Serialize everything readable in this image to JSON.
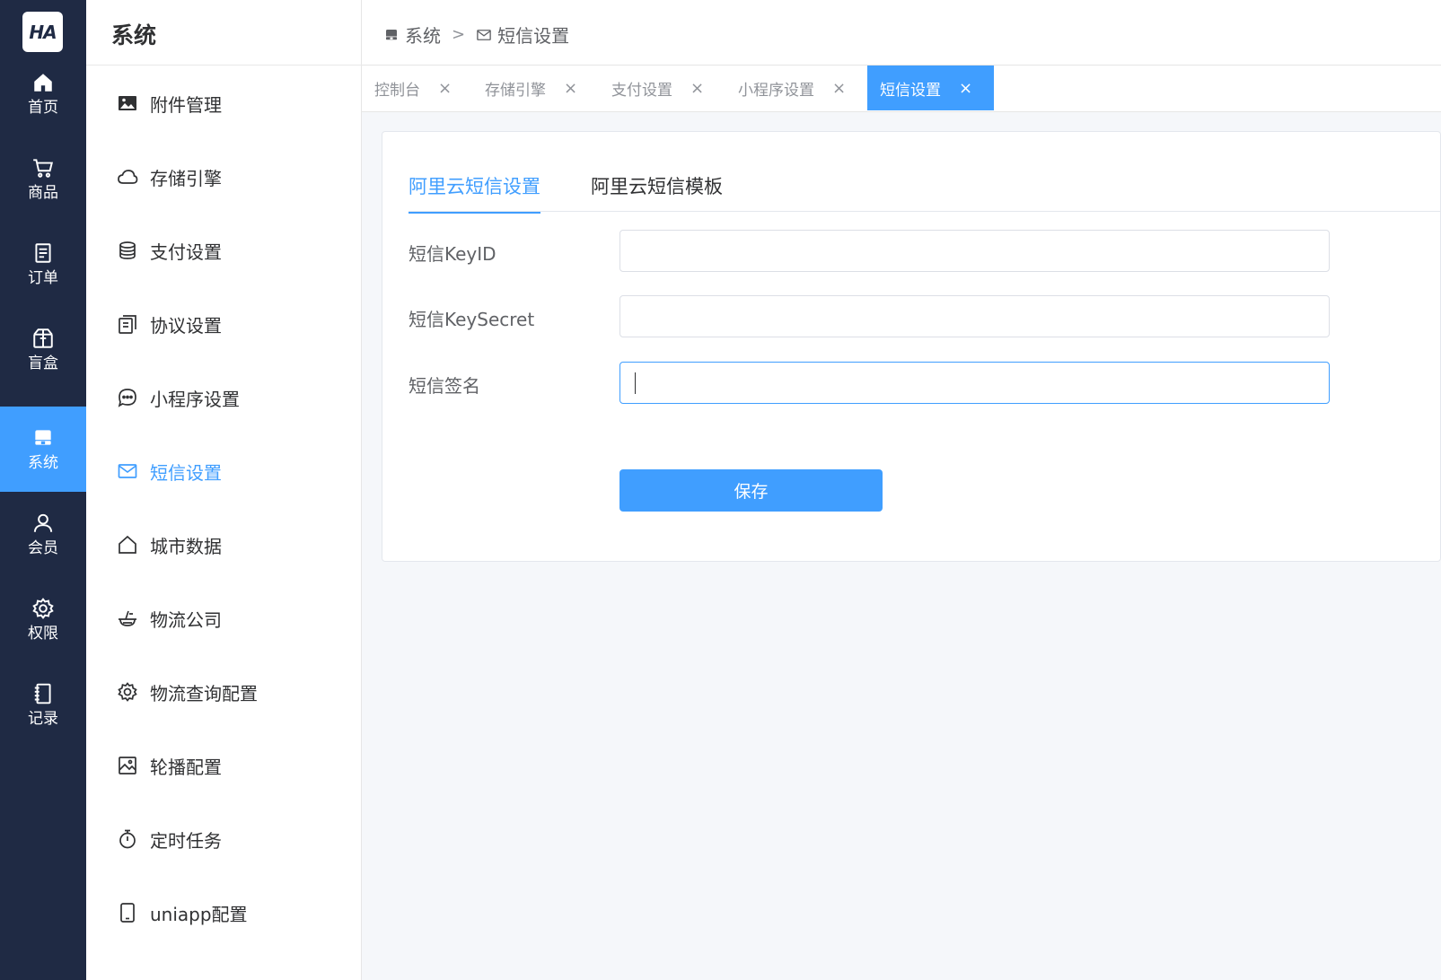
{
  "brand": {
    "logo_text": "HA"
  },
  "rail": {
    "items": [
      {
        "label": "首页",
        "icon": "home-icon"
      },
      {
        "label": "商品",
        "icon": "cart-icon"
      },
      {
        "label": "订单",
        "icon": "order-icon"
      },
      {
        "label": "盲盒",
        "icon": "box-icon"
      },
      {
        "label": "系统",
        "icon": "system-icon",
        "active": true
      },
      {
        "label": "会员",
        "icon": "user-icon"
      },
      {
        "label": "权限",
        "icon": "gear-icon"
      },
      {
        "label": "记录",
        "icon": "notebook-icon"
      }
    ]
  },
  "sidebar": {
    "title": "系统",
    "items": [
      {
        "label": "附件管理",
        "icon": "picture-icon"
      },
      {
        "label": "存储引擎",
        "icon": "cloud-icon"
      },
      {
        "label": "支付设置",
        "icon": "coins-icon"
      },
      {
        "label": "协议设置",
        "icon": "document-icon"
      },
      {
        "label": "小程序设置",
        "icon": "chat-dots-icon"
      },
      {
        "label": "短信设置",
        "icon": "message-icon",
        "active": true
      },
      {
        "label": "城市数据",
        "icon": "house-icon"
      },
      {
        "label": "物流公司",
        "icon": "bowl-icon"
      },
      {
        "label": "物流查询配置",
        "icon": "setting-icon"
      },
      {
        "label": "轮播配置",
        "icon": "image-icon"
      },
      {
        "label": "定时任务",
        "icon": "stopwatch-icon"
      },
      {
        "label": "uniapp配置",
        "icon": "phone-icon"
      }
    ]
  },
  "breadcrumb": {
    "parent": "系统",
    "current": "短信设置",
    "separator": ">"
  },
  "tabs": [
    {
      "label": "控制台",
      "close": "×"
    },
    {
      "label": "存储引擎",
      "close": "×"
    },
    {
      "label": "支付设置",
      "close": "×"
    },
    {
      "label": "小程序设置",
      "close": "×"
    },
    {
      "label": "短信设置",
      "close": "×",
      "active": true
    }
  ],
  "content": {
    "tabs": [
      {
        "label": "阿里云短信设置",
        "active": true
      },
      {
        "label": "阿里云短信模板"
      }
    ],
    "form": {
      "fields": [
        {
          "label": "短信KeyID",
          "value": ""
        },
        {
          "label": "短信KeySecret",
          "value": ""
        },
        {
          "label": "短信签名",
          "value": "",
          "focused": true
        }
      ],
      "save_label": "保存"
    }
  },
  "colors": {
    "rail_bg": "#1f2a44",
    "accent": "#409eff",
    "page_bg": "#f5f7fa"
  }
}
